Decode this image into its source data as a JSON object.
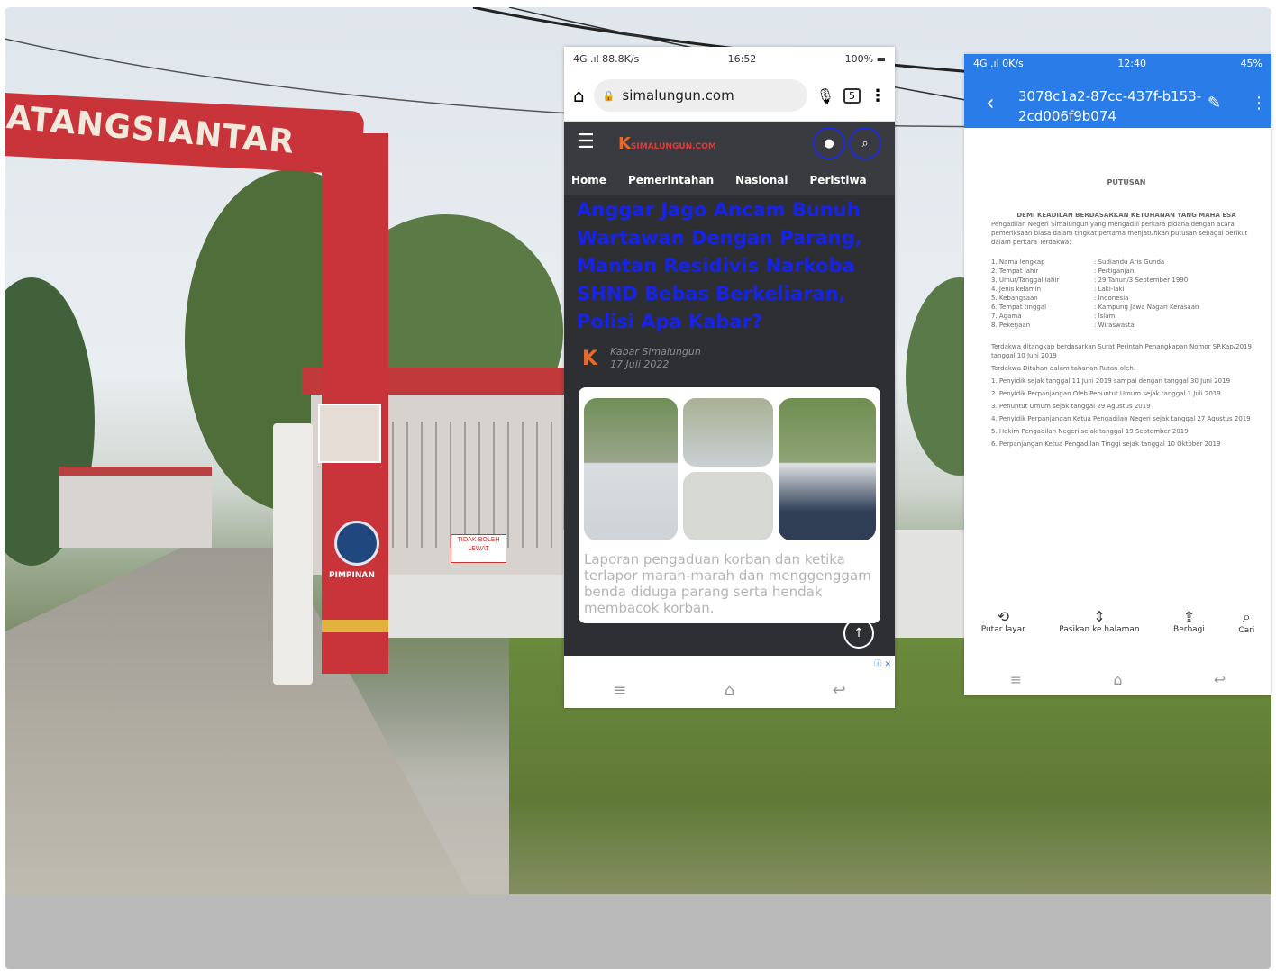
{
  "background": {
    "gate_sign": "ATANGSIANTAR",
    "badge_text": "PIMPINAN",
    "wall_sign": "TIDAK BOLEH LEWAT"
  },
  "phone_left": {
    "status": {
      "left": "4G .ıl 88.8K/s",
      "time": "16:52",
      "right": "100%"
    },
    "browser": {
      "url": "simalungun.com",
      "tab_count": "5"
    },
    "site": {
      "logo_text": "SIMALUNGUN.COM"
    },
    "nav": [
      "Home",
      "Pemerintahan",
      "Nasional",
      "Peristiwa"
    ],
    "headline": "Anggar Jago Ancam Bunuh Wartawan Dengan Parang, Mantan Residivis Narkoba SHND Bebas Berkeliaran, Polisi Apa Kabar?",
    "author": "Kabar Simalungun",
    "date": "17 Juli 2022",
    "caption": "Laporan pengaduan korban dan ketika terlapor marah-marah dan menggenggam benda diduga parang serta hendak membacok korban.",
    "ad_close": "ⓘ ✕"
  },
  "phone_right": {
    "status": {
      "left": "4G .ıl 0K/s",
      "time": "12:40",
      "right": "45%"
    },
    "doc_title": "3078c1a2-87cc-437f-b153-2cd006f9b074",
    "document": {
      "heading": "PUTUSAN",
      "subheading": "DEMI KEADILAN BERDASARKAN KETUHANAN YANG MAHA ESA",
      "intro": "Pengadilan Negeri Simalungun yang mengadili perkara pidana dengan acara pemeriksaan biasa dalam tingkat pertama menjatuhkan putusan sebagai berikut dalam perkara Terdakwa:",
      "fields": [
        {
          "k": "1. Nama lengkap",
          "v": ": Sudiandu Aris Gunda"
        },
        {
          "k": "2. Tempat lahir",
          "v": ": Pertiganjan"
        },
        {
          "k": "3. Umur/Tanggal lahir",
          "v": ": 29 Tahun/3 September 1990"
        },
        {
          "k": "4. Jenis kelamin",
          "v": ": Laki-laki"
        },
        {
          "k": "5. Kebangsaan",
          "v": ": Indonesia"
        },
        {
          "k": "6. Tempat tinggal",
          "v": ": Kampung Jawa Nagari Kerasaan"
        },
        {
          "k": "7. Agama",
          "v": ": Islam"
        },
        {
          "k": "8. Pekerjaan",
          "v": ": Wiraswasta"
        }
      ],
      "body": [
        "Terdakwa ditangkap berdasarkan Surat Perintah Penangkapan Nomor SP.Kap/2019 tanggal 10 Juni 2019",
        "Terdakwa Ditahan dalam tahanan Rutan oleh:",
        "1. Penyidik sejak tanggal 11 Juni 2019 sampai dengan tanggal 30 Juni 2019",
        "2. Penyidik Perpanjangan Oleh Penuntut Umum sejak tanggal 1 Juli 2019",
        "3. Penuntut Umum sejak tanggal 29 Agustus 2019",
        "4. Penyidik Perpanjangan Ketua Pengadilan Negeri sejak tanggal 27 Agustus 2019",
        "5. Hakim Pengadilan Negeri sejak tanggal 19 September 2019",
        "6. Perpanjangan Ketua Pengadilan Tinggi sejak tanggal 10 Oktober 2019"
      ]
    },
    "toolbar": [
      "Putar layar",
      "Pasikan ke halaman",
      "Berbagi",
      "Cari"
    ]
  }
}
